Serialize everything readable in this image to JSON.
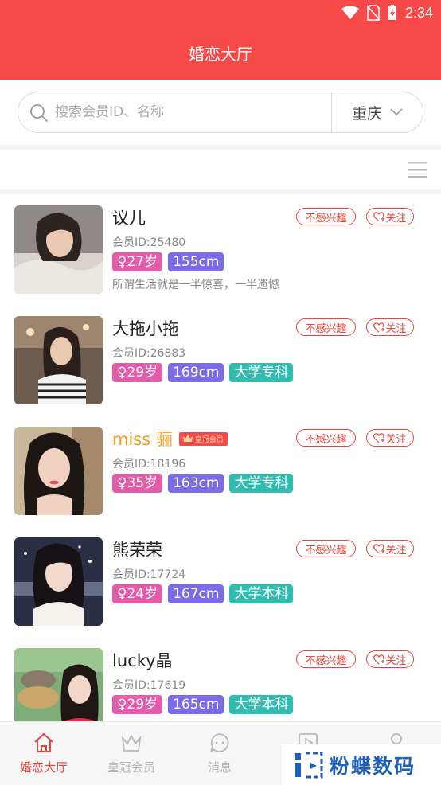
{
  "status_bar": {
    "time": "2:34"
  },
  "header": {
    "title": "婚恋大厅"
  },
  "search": {
    "placeholder": "搜索会员ID、名称",
    "value": "",
    "city": "重庆"
  },
  "members": [
    {
      "name": "议儿",
      "member_id": "会员ID:25480",
      "age": "♀27岁",
      "height": "155cm",
      "education": "",
      "motto": "所谓生活就是一半惊喜，一半遗憾",
      "vip": false
    },
    {
      "name": "大拖小拖",
      "member_id": "会员ID:26883",
      "age": "♀29岁",
      "height": "169cm",
      "education": "大学专科",
      "motto": "",
      "vip": false
    },
    {
      "name": "miss 骊",
      "member_id": "会员ID:18196",
      "age": "♀35岁",
      "height": "163cm",
      "education": "大学专科",
      "motto": "",
      "vip": true,
      "vip_label": "皇冠会员"
    },
    {
      "name": "熊荣荣",
      "member_id": "会员ID:17724",
      "age": "♀24岁",
      "height": "167cm",
      "education": "大学本科",
      "motto": "",
      "vip": false
    },
    {
      "name": "lucky晶",
      "member_id": "会员ID:17619",
      "age": "♀29岁",
      "height": "165cm",
      "education": "大学本科",
      "motto": "",
      "vip": false
    }
  ],
  "actions": {
    "not_interested": "不感兴趣",
    "follow": "关注"
  },
  "tabs": [
    {
      "label": "婚恋大厅",
      "icon": "home-icon",
      "active": true
    },
    {
      "label": "皇冠会员",
      "icon": "crown-icon",
      "active": false
    },
    {
      "label": "消息",
      "icon": "message-icon",
      "active": false
    },
    {
      "label": "",
      "icon": "video-icon",
      "active": false
    },
    {
      "label": "",
      "icon": "profile-icon",
      "active": false
    }
  ],
  "watermark": {
    "text": "粉蝶数码"
  },
  "colors": {
    "brand": "#f64948",
    "age_tag": "#e45ba9",
    "height_tag": "#7b6be8",
    "education_tag": "#30bcae",
    "vip_name": "#f49b1e"
  }
}
